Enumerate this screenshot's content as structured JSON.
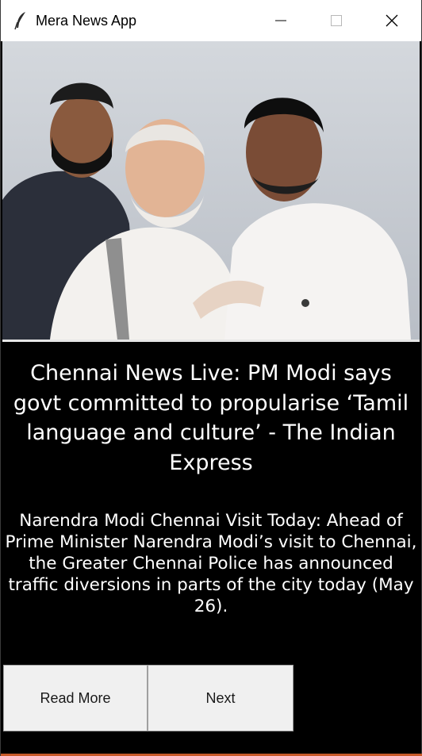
{
  "window": {
    "title": "Mera News App",
    "icon": "feather-icon"
  },
  "article": {
    "headline": "Chennai News Live: PM Modi says govt committed to propularise ‘Tamil language and culture’ - The Indian Express",
    "description": "Narendra Modi Chennai Visit Today: Ahead of Prime Minister Narendra Modi’s visit to Chennai, the Greater Chennai Police has announced traffic diversions in parts of the city today (May 26)."
  },
  "buttons": {
    "read_more": "Read More",
    "next": "Next"
  },
  "colors": {
    "background": "#000000",
    "titlebar": "#ffffff",
    "text": "#ffffff",
    "button_face": "#f0f0f0"
  }
}
